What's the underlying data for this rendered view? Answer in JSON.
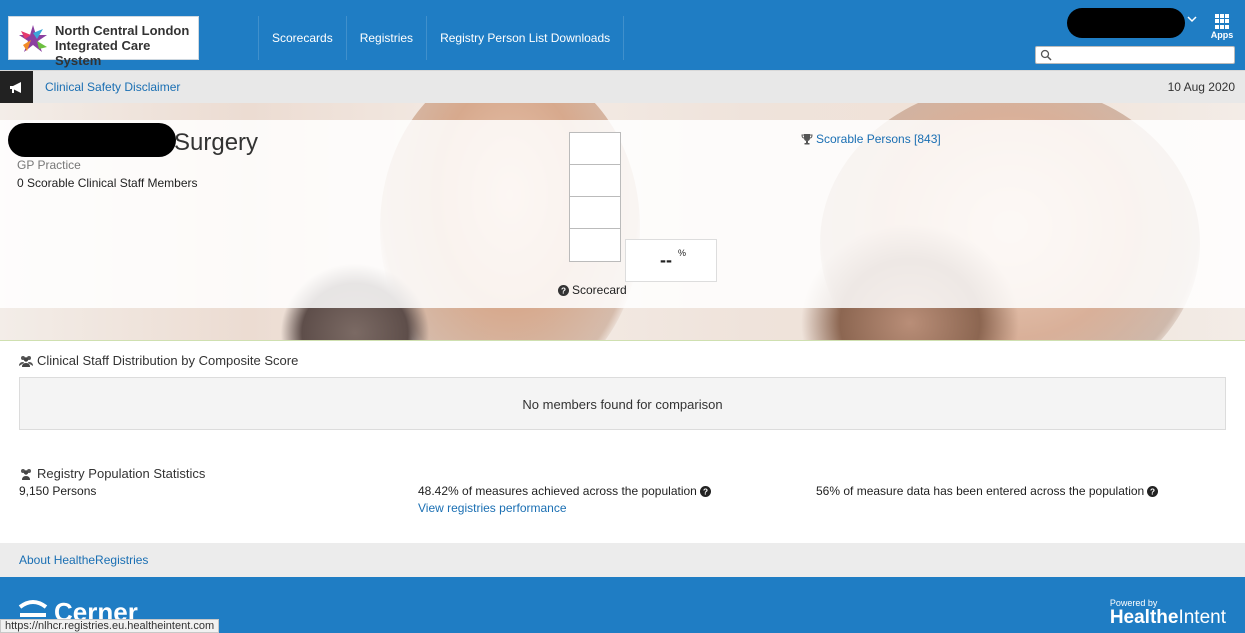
{
  "header": {
    "logo_line1": "North Central London",
    "logo_line2": "Integrated Care System",
    "nav": [
      "Scorecards",
      "Registries",
      "Registry Person List Downloads"
    ],
    "apps_label": "Apps",
    "search": {
      "value": "",
      "placeholder": ""
    }
  },
  "strip": {
    "disclaimer": "Clinical Safety Disclaimer",
    "date": "10 Aug 2020"
  },
  "practice": {
    "name_suffix": "Surgery",
    "type": "GP Practice",
    "staff_members": "0 Scorable Clinical Staff Members"
  },
  "score": {
    "value": "--",
    "unit": "%",
    "label": "Scorecard",
    "scorable_persons": "Scorable Persons [843]"
  },
  "distribution": {
    "title": "Clinical Staff Distribution by Composite Score",
    "empty": "No members found for comparison"
  },
  "population": {
    "title": "Registry Population Statistics",
    "persons": "9,150 Persons",
    "measures": "48.42% of measures achieved across the population",
    "view_link": "View registries performance",
    "entered": "56% of measure data has been entered across the population"
  },
  "about": "About HealtheRegistries",
  "footer": {
    "cerner": "Cerner",
    "powered_label": "Powered by",
    "brand_bold": "Healthe",
    "brand_light": "Intent"
  },
  "status_url": "https://nlhcr.registries.eu.healtheintent.com",
  "colors": {
    "brand_blue": "#1f7dc4",
    "link": "#1a6fb3"
  }
}
